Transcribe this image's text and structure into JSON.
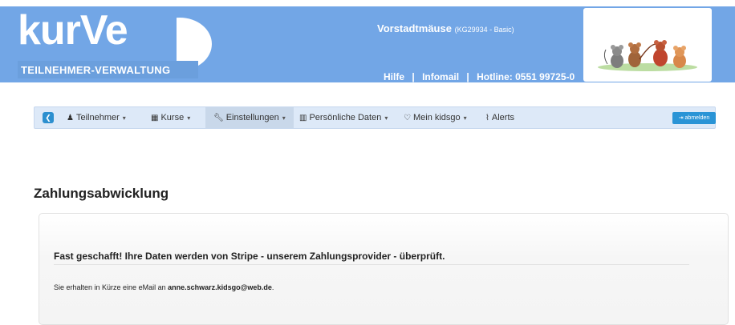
{
  "header": {
    "logo": "kurVe",
    "logo_sub": "TEILNEHMER-VERWALTUNG",
    "org_name": "Vorstadtmäuse",
    "org_meta": "(KG29934 - Basic)",
    "links": {
      "help": "Hilfe",
      "infomail": "Infomail",
      "hotline": "Hotline: 0551 99725-0",
      "separator": "|"
    },
    "mascot_icon": "mice-illustration"
  },
  "navbar": {
    "home_icon": "home-circle-icon",
    "items": [
      {
        "label": "Teilnehmer",
        "icon": "user-icon",
        "dropdown": true
      },
      {
        "label": "Kurse",
        "icon": "calendar-icon",
        "dropdown": true
      },
      {
        "label": "Einstellungen",
        "icon": "wrench-icon",
        "dropdown": true,
        "active": true
      },
      {
        "label": "Persönliche Daten",
        "icon": "barcode-icon",
        "dropdown": true
      },
      {
        "label": "Mein kidsgo",
        "icon": "heart-icon",
        "dropdown": true
      },
      {
        "label": "Alerts",
        "icon": "rss-icon",
        "dropdown": false
      }
    ],
    "logout_label": "abmelden"
  },
  "content": {
    "heading": "Zahlungsabwicklung",
    "panel_title": "Fast geschafft! Ihre Daten werden von Stripe - unserem Zahlungsprovider - überprüft.",
    "panel_text_prefix": "Sie erhalten in Kürze eine eMail an ",
    "panel_email": "anne.schwarz.kidsgo@web.de",
    "panel_text_suffix": "."
  },
  "colors": {
    "header_bg": "#72a6e6",
    "navbar_bg": "#dde9f8",
    "logout_bg": "#2a94d6"
  }
}
